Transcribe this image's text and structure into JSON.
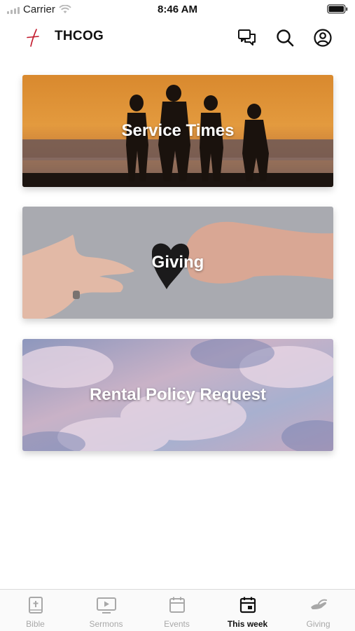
{
  "status_bar": {
    "carrier": "Carrier",
    "time": "8:46 AM",
    "icons": [
      "signal-icon",
      "wifi-icon",
      "battery-icon"
    ]
  },
  "header": {
    "title": "THCOG",
    "accent_color": "#c2182b",
    "icons": [
      "chat-icon",
      "search-icon",
      "profile-icon"
    ]
  },
  "cards": [
    {
      "title": "Service Times"
    },
    {
      "title": "Giving"
    },
    {
      "title": "Rental Policy Request"
    }
  ],
  "tabs": [
    {
      "label": "Bible",
      "icon": "bible-icon",
      "active": false
    },
    {
      "label": "Sermons",
      "icon": "play-screen-icon",
      "active": false
    },
    {
      "label": "Events",
      "icon": "calendar-icon",
      "active": false
    },
    {
      "label": "This week",
      "icon": "calendar-day-icon",
      "active": true
    },
    {
      "label": "Giving",
      "icon": "giving-hand-icon",
      "active": false
    }
  ]
}
